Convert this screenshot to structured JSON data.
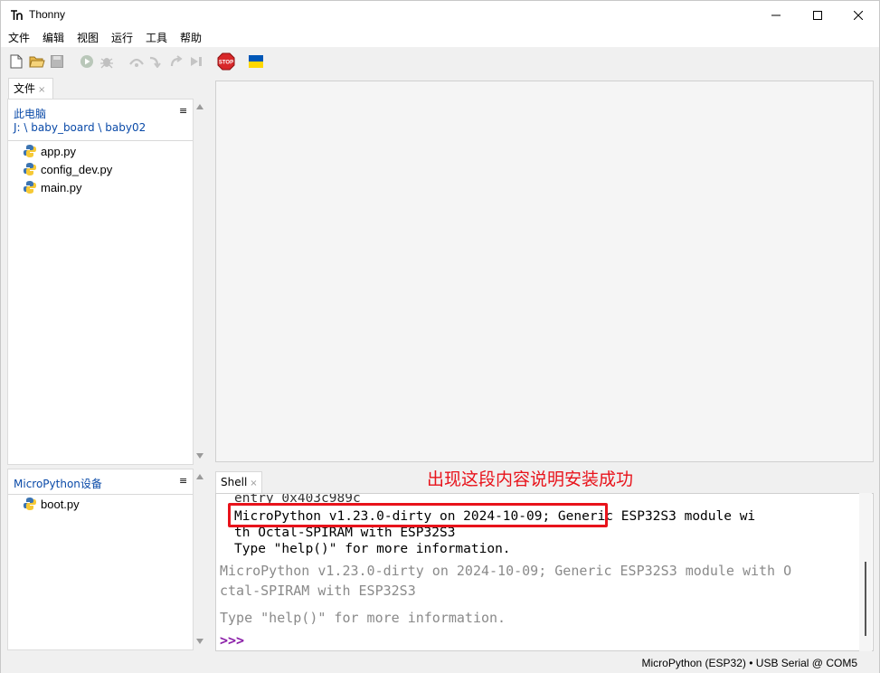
{
  "window": {
    "title": "Thonny",
    "icon": "thonny-logo-icon"
  },
  "menu": [
    "文件",
    "编辑",
    "视图",
    "运行",
    "工具",
    "帮助"
  ],
  "toolbar": {
    "icons": [
      "new-file-icon",
      "open-file-icon",
      "save-icon",
      "run-icon",
      "debug-icon",
      "step-over-icon",
      "step-into-icon",
      "step-out-icon",
      "resume-icon",
      "stop-icon",
      "ukraine-flag-icon"
    ],
    "stop_label": "STOP"
  },
  "files_panel": {
    "tab_label": "文件",
    "tab_close": "×",
    "computer": {
      "header": "此电脑",
      "path": "J: \\ baby_board \\ baby02",
      "files": [
        "app.py",
        "config_dev.py",
        "main.py"
      ]
    },
    "device": {
      "header": "MicroPython设备",
      "files": [
        "boot.py"
      ]
    },
    "menu_glyph": "≡"
  },
  "shell": {
    "tab_label": "Shell",
    "tab_close": "×",
    "output_lines": [
      "entry 0x403c989c",
      "MicroPython v1.23.0-dirty on 2024-10-09; Generic ESP32S3 module wi",
      "th Octal-SPIRAM with ESP32S3",
      "Type \"help()\" for more information."
    ],
    "repl_lines": [
      "MicroPython v1.23.0-dirty on 2024-10-09; Generic ESP32S3 module with O",
      "ctal-SPIRAM with ESP32S3",
      "",
      "Type \"help()\" for more information."
    ],
    "prompt": ">>>"
  },
  "annotation": {
    "text": "出现这段内容说明安装成功",
    "color": "#e8131b"
  },
  "status_bar": {
    "interpreter": "MicroPython (ESP32)",
    "separator": "•",
    "port": "USB Serial @ COM5"
  },
  "colors": {
    "accent_blue": "#0a4aa8",
    "prompt_purple": "#8b1fa8",
    "highlight_red": "#e8131b"
  }
}
